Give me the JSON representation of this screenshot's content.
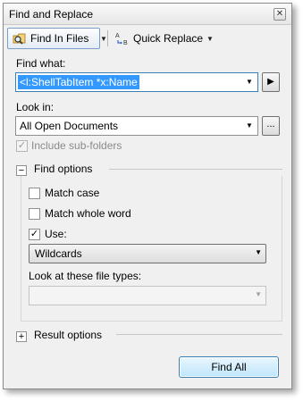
{
  "window": {
    "title": "Find and Replace",
    "close_glyph": "✕"
  },
  "toolbar": {
    "find_in_files_label": "Find In Files",
    "quick_replace_label": "Quick Replace",
    "active_tab": "Find In Files",
    "icons": [
      "find-in-files-icon",
      "quick-replace-icon",
      "chevron-down-icon"
    ]
  },
  "find_what": {
    "label": "Find what:",
    "value": "<l:ShellTabItem *x:Name"
  },
  "look_in": {
    "label": "Look in:",
    "value": "All Open Documents",
    "browse_label": "..."
  },
  "include_subfolders": {
    "label": "Include sub-folders",
    "checked": true,
    "enabled": false
  },
  "find_options": {
    "label": "Find options",
    "expanded": true,
    "match_case_label": "Match case",
    "match_case_checked": false,
    "match_whole_word_label": "Match whole word",
    "match_whole_word_checked": false,
    "use_label": "Use:",
    "use_checked": true,
    "use_value": "Wildcards",
    "file_types_label": "Look at these file types:",
    "file_types_value": ""
  },
  "result_options": {
    "label": "Result options",
    "expanded": false
  },
  "actions": {
    "find_all_label": "Find All"
  },
  "colors": {
    "selection": "#3399ff",
    "primary_button": "#bee6fd",
    "window_bg": "#f0f0f0"
  }
}
